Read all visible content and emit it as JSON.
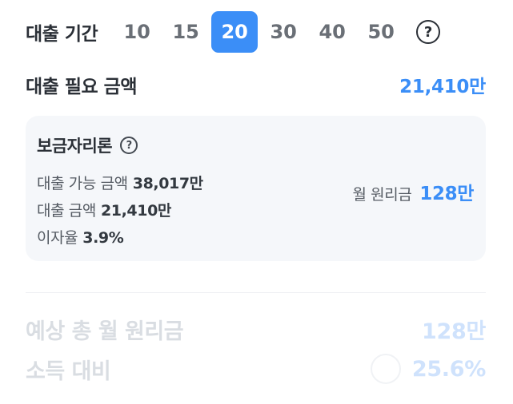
{
  "period": {
    "label": "대출 기간",
    "options": [
      "10",
      "15",
      "20",
      "30",
      "40",
      "50"
    ],
    "selected": "20",
    "help_glyph": "?"
  },
  "need": {
    "label": "대출 필요 금액",
    "value": "21,410만"
  },
  "product": {
    "name": "보금자리론",
    "help_glyph": "?",
    "available_label": "대출 가능 금액",
    "available_value": "38,017만",
    "loan_label": "대출 금액",
    "loan_value": "21,410만",
    "rate_label": "이자율",
    "rate_value": "3.9%",
    "monthly_label": "월 원리금",
    "monthly_value": "128만"
  },
  "summary": {
    "monthly_label": "예상 총 월 원리금",
    "monthly_value": "128만",
    "ratio_label": "소득 대비",
    "ratio_value": "25.6%"
  },
  "colors": {
    "accent": "#3b8ef7",
    "card_bg": "#f5f7fa",
    "faded_text": "#d9dde2",
    "faded_accent": "#cfe2fc"
  },
  "icons": {
    "period_help": "question-circle-icon",
    "product_help": "question-circle-icon"
  }
}
